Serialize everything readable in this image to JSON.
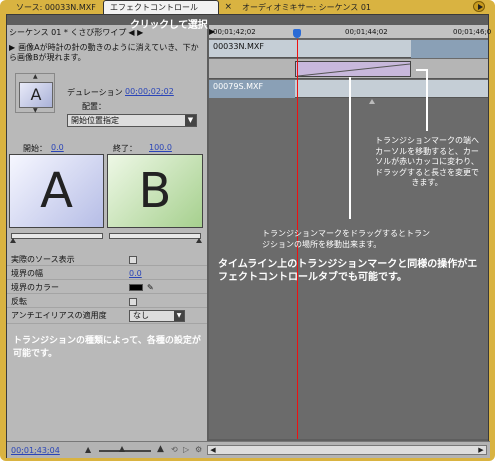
{
  "tabs": {
    "source": "ソース: 00033N.MXF",
    "effect_controls": "エフェクトコントロール",
    "close": "×",
    "audio_mixer": "オーディオミキサー: シーケンス 01"
  },
  "annotations": {
    "click_select": "クリックして選択",
    "left_note": "トランジションの種類によって、各種の設定が可能です。",
    "right_note": "トランジションマークの端へカーソルを移動すると、カーソルが赤いカッコに変わり、ドラッグすると長さを変更できます。",
    "mid_note": "トランジションマークをドラッグするとトランジションの場所を移動出来ます。",
    "big_note": "タイムライン上のトランジションマークと同様の操作がエフェクトコントロールタブでも可能です。"
  },
  "effect_panel": {
    "sequence_title": "シーケンス 01 * くさび形ワイプ",
    "title_arrows": "◀ ▶",
    "description": "画像Aが時計の針の動きのように消えていき、下から画像Bが現れます。",
    "thumb_letter": "A",
    "duration_label": "デュレーション",
    "duration_value": "00;00;02;02",
    "alignment_label": "配置：",
    "alignment_value": "開始位置指定",
    "start_label": "開始：",
    "start_value": "0.0",
    "end_label": "終了：",
    "end_value": "100.0",
    "preview_a": "A",
    "preview_b": "B",
    "show_source_label": "実際のソース表示",
    "border_width_label": "境界の幅",
    "border_width_value": "0.0",
    "border_color_label": "境界のカラー",
    "reverse_label": "反転",
    "antialias_label": "アンチエイリアスの適用度",
    "antialias_value": "なし"
  },
  "timeline": {
    "timecode_1": "00;01;42;02",
    "timecode_2": "00;01;44;02",
    "timecode_3": "00;01;46;0",
    "clip_a": "00033N.MXF",
    "clip_b": "00079S.MXF"
  },
  "bottom": {
    "time_readout": "00;01;43;04"
  },
  "colors": {
    "frame": "#d9b341",
    "playhead": "#ee1111",
    "link": "#2a45b8",
    "transition_mark": "#c8b8dc"
  }
}
